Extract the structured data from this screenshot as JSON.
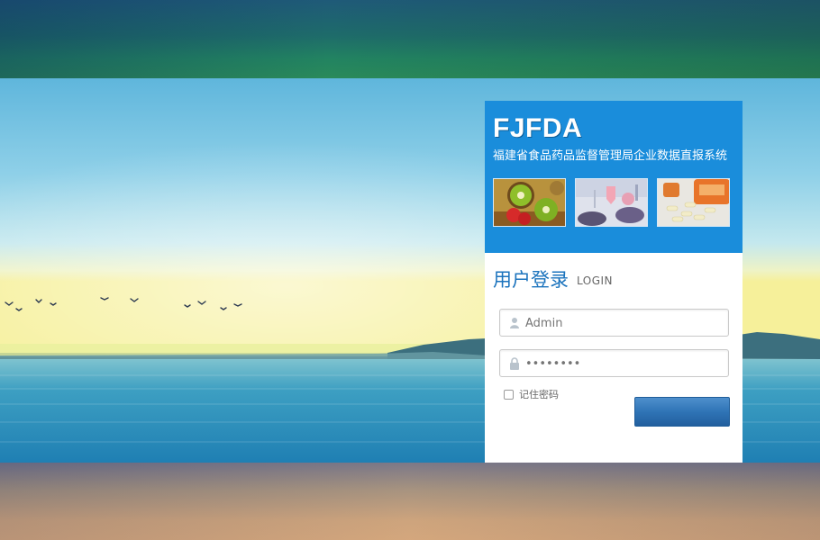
{
  "header": {
    "logo_text": "FJFDA",
    "subtitle": "福建省食品药品监督管理局企业数据直报系统"
  },
  "images": {
    "thumb1": "fruit-photo",
    "thumb2": "lab-pills-photo",
    "thumb3": "capsule-bottle-photo"
  },
  "login": {
    "title": "用户登录",
    "title_en": "LOGIN",
    "username": {
      "value": "",
      "placeholder": "Admin"
    },
    "password": {
      "value": "",
      "placeholder": "••••••••"
    },
    "remember_label": "记住密码",
    "submit_label": ""
  },
  "colors": {
    "panel_blue": "#1a8ddb",
    "title_blue": "#1b73bd",
    "button_blue": "#2f74b6"
  },
  "icons": {
    "user": "user-icon",
    "lock": "lock-icon"
  }
}
